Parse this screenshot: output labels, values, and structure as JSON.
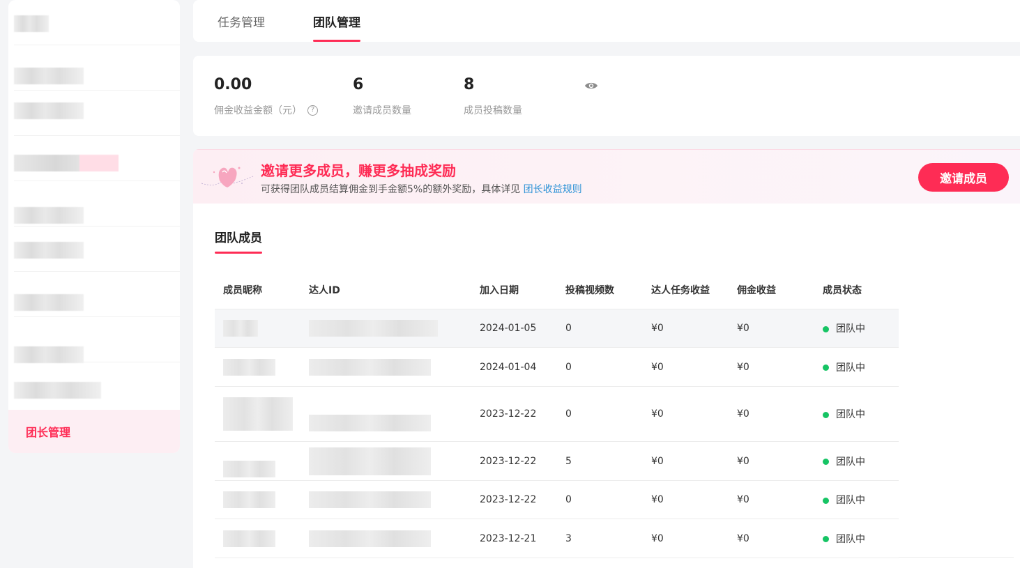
{
  "sidebar": {
    "active_item": "团长管理"
  },
  "tabs": [
    {
      "label": "任务管理",
      "active": false
    },
    {
      "label": "团队管理",
      "active": true
    }
  ],
  "stats": [
    {
      "value": "0.00",
      "label": "佣金收益金额（元）",
      "help": true
    },
    {
      "value": "6",
      "label": "邀请成员数量"
    },
    {
      "value": "8",
      "label": "成员投稿数量"
    }
  ],
  "banner": {
    "title": "邀请更多成员，赚更多抽成奖励",
    "desc": "可获得团队成员结算佣金到手金额5%的额外奖励，具体详见",
    "link": "团长收益规则",
    "button": "邀请成员"
  },
  "section_tab": "团队成员",
  "table": {
    "columns": [
      "成员昵称",
      "达人ID",
      "加入日期",
      "投稿视频数",
      "达人任务收益",
      "佣金收益",
      "成员状态"
    ],
    "rows": [
      {
        "date": "2024-01-05",
        "videos": "0",
        "task_income": "¥0",
        "commission": "¥0",
        "status": "团队中"
      },
      {
        "date": "2024-01-04",
        "videos": "0",
        "task_income": "¥0",
        "commission": "¥0",
        "status": "团队中"
      },
      {
        "date": "2023-12-22",
        "videos": "0",
        "task_income": "¥0",
        "commission": "¥0",
        "status": "团队中"
      },
      {
        "date": "2023-12-22",
        "videos": "5",
        "task_income": "¥0",
        "commission": "¥0",
        "status": "团队中"
      },
      {
        "date": "2023-12-22",
        "videos": "0",
        "task_income": "¥0",
        "commission": "¥0",
        "status": "团队中"
      },
      {
        "date": "2023-12-21",
        "videos": "3",
        "task_income": "¥0",
        "commission": "¥0",
        "status": "团队中"
      }
    ]
  },
  "colors": {
    "accent": "#fe2c55",
    "link": "#2e93d6",
    "status_green": "#16c464"
  }
}
